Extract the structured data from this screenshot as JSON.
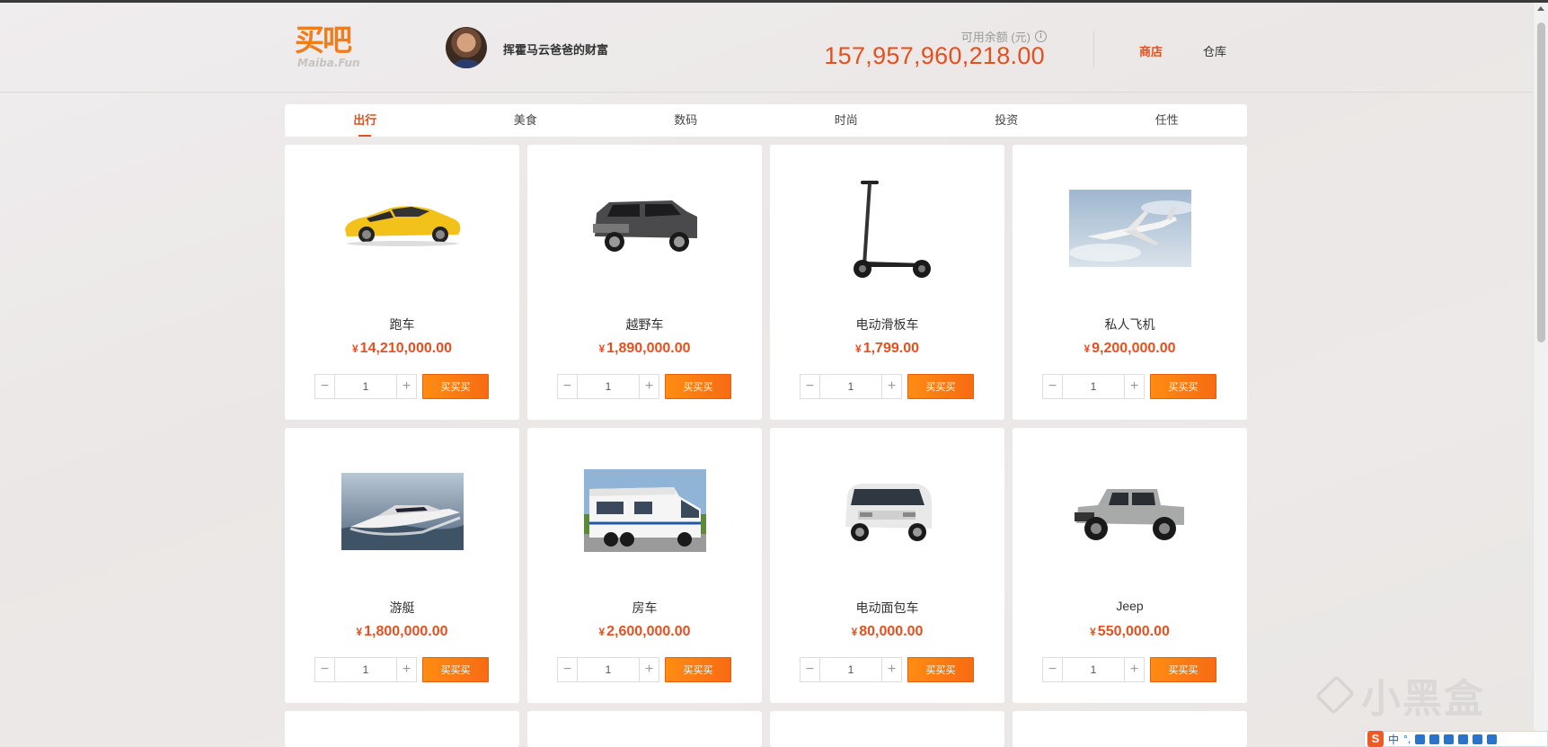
{
  "header": {
    "logo_cn": "买吧",
    "logo_en": "Maiba.Fun",
    "user_name": "挥霍马云爸爸的财富",
    "balance_label": "可用余额 (元)",
    "info_icon": "i",
    "balance": "157,957,960,218.00",
    "nav": {
      "shop": "商店",
      "warehouse": "仓库"
    }
  },
  "tabs": [
    {
      "label": "出行",
      "active": true
    },
    {
      "label": "美食"
    },
    {
      "label": "数码"
    },
    {
      "label": "时尚"
    },
    {
      "label": "投资"
    },
    {
      "label": "任性"
    }
  ],
  "currency": "¥",
  "buy_label": "买买买",
  "stepper": {
    "minus": "−",
    "plus": "+"
  },
  "products": [
    {
      "name": "跑车",
      "price": "14,210,000.00",
      "qty": "1",
      "image": "sports-car"
    },
    {
      "name": "越野车",
      "price": "1,890,000.00",
      "qty": "1",
      "image": "suv"
    },
    {
      "name": "电动滑板车",
      "price": "1,799.00",
      "qty": "1",
      "image": "scooter"
    },
    {
      "name": "私人飞机",
      "price": "9,200,000.00",
      "qty": "1",
      "image": "private-jet"
    },
    {
      "name": "游艇",
      "price": "1,800,000.00",
      "qty": "1",
      "image": "yacht"
    },
    {
      "name": "房车",
      "price": "2,600,000.00",
      "qty": "1",
      "image": "motorhome"
    },
    {
      "name": "电动面包车",
      "price": "80,000.00",
      "qty": "1",
      "image": "minivan"
    },
    {
      "name": "Jeep",
      "price": "550,000.00",
      "qty": "1",
      "image": "jeep"
    }
  ],
  "watermark": "小黑盒",
  "ime": {
    "logo": "S",
    "mode": "中",
    "punct": "°,"
  },
  "colors": {
    "accent": "#e5501f",
    "button": "#ff8c12"
  }
}
